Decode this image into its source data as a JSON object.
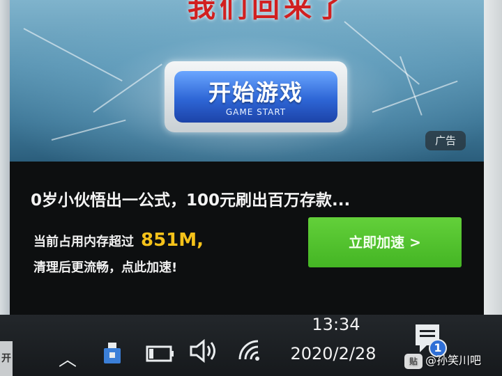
{
  "ad": {
    "banner_title": "我们回来了",
    "start_button_cn": "开始游戏",
    "start_button_en": "GAME START",
    "ad_tag": "广告",
    "headline": "0岁小伙悟出一公式，100元刷出百万存款...",
    "memory_prefix": "当前占用内存超过",
    "memory_value": "851M,",
    "cleanup_text": "清理后更流畅，点此加速!",
    "speed_button": "立即加速 >",
    "colors": {
      "highlight": "#f5c21a",
      "button_green": "#4fc02c",
      "start_blue": "#2e66d6"
    }
  },
  "taskbar": {
    "start_edge_label": "开",
    "tray_icons": [
      "chevron-up-icon",
      "usb-icon",
      "battery-icon",
      "volume-icon",
      "wifi-icon"
    ],
    "time": "13:34",
    "date": "2020/2/28",
    "notification_count": "1"
  },
  "watermark": {
    "badge": "贴",
    "text": "@孙笑川吧"
  }
}
